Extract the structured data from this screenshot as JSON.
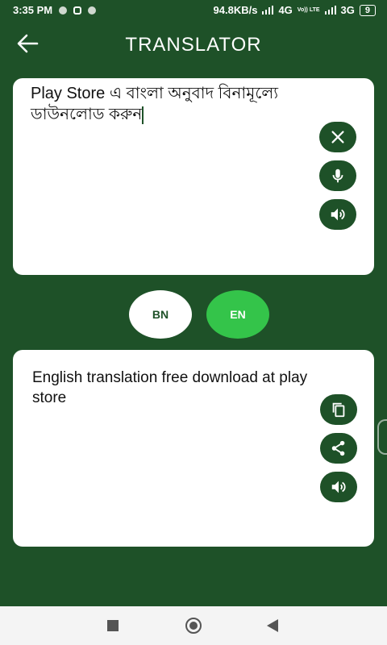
{
  "status_bar": {
    "time": "3:35 PM",
    "speed": "94.8KB/s",
    "network1": "4G",
    "volte": "Vo)) LTE",
    "network2": "3G",
    "battery": "9"
  },
  "app_bar": {
    "title": "TRANSLATOR",
    "back_icon": "arrow-left-icon"
  },
  "source": {
    "text": "Play Store এ বাংলা অনুবাদ বিনামূল্যে ডাউনলোড করুন",
    "actions": [
      "close-icon",
      "mic-icon",
      "speaker-icon"
    ]
  },
  "languages": {
    "source": "BN",
    "target": "EN"
  },
  "output": {
    "text": "English translation free download at play store",
    "actions": [
      "copy-icon",
      "share-icon",
      "speaker-icon"
    ]
  },
  "colors": {
    "primary": "#1e5128",
    "accent": "#34c44a",
    "card": "#ffffff"
  }
}
